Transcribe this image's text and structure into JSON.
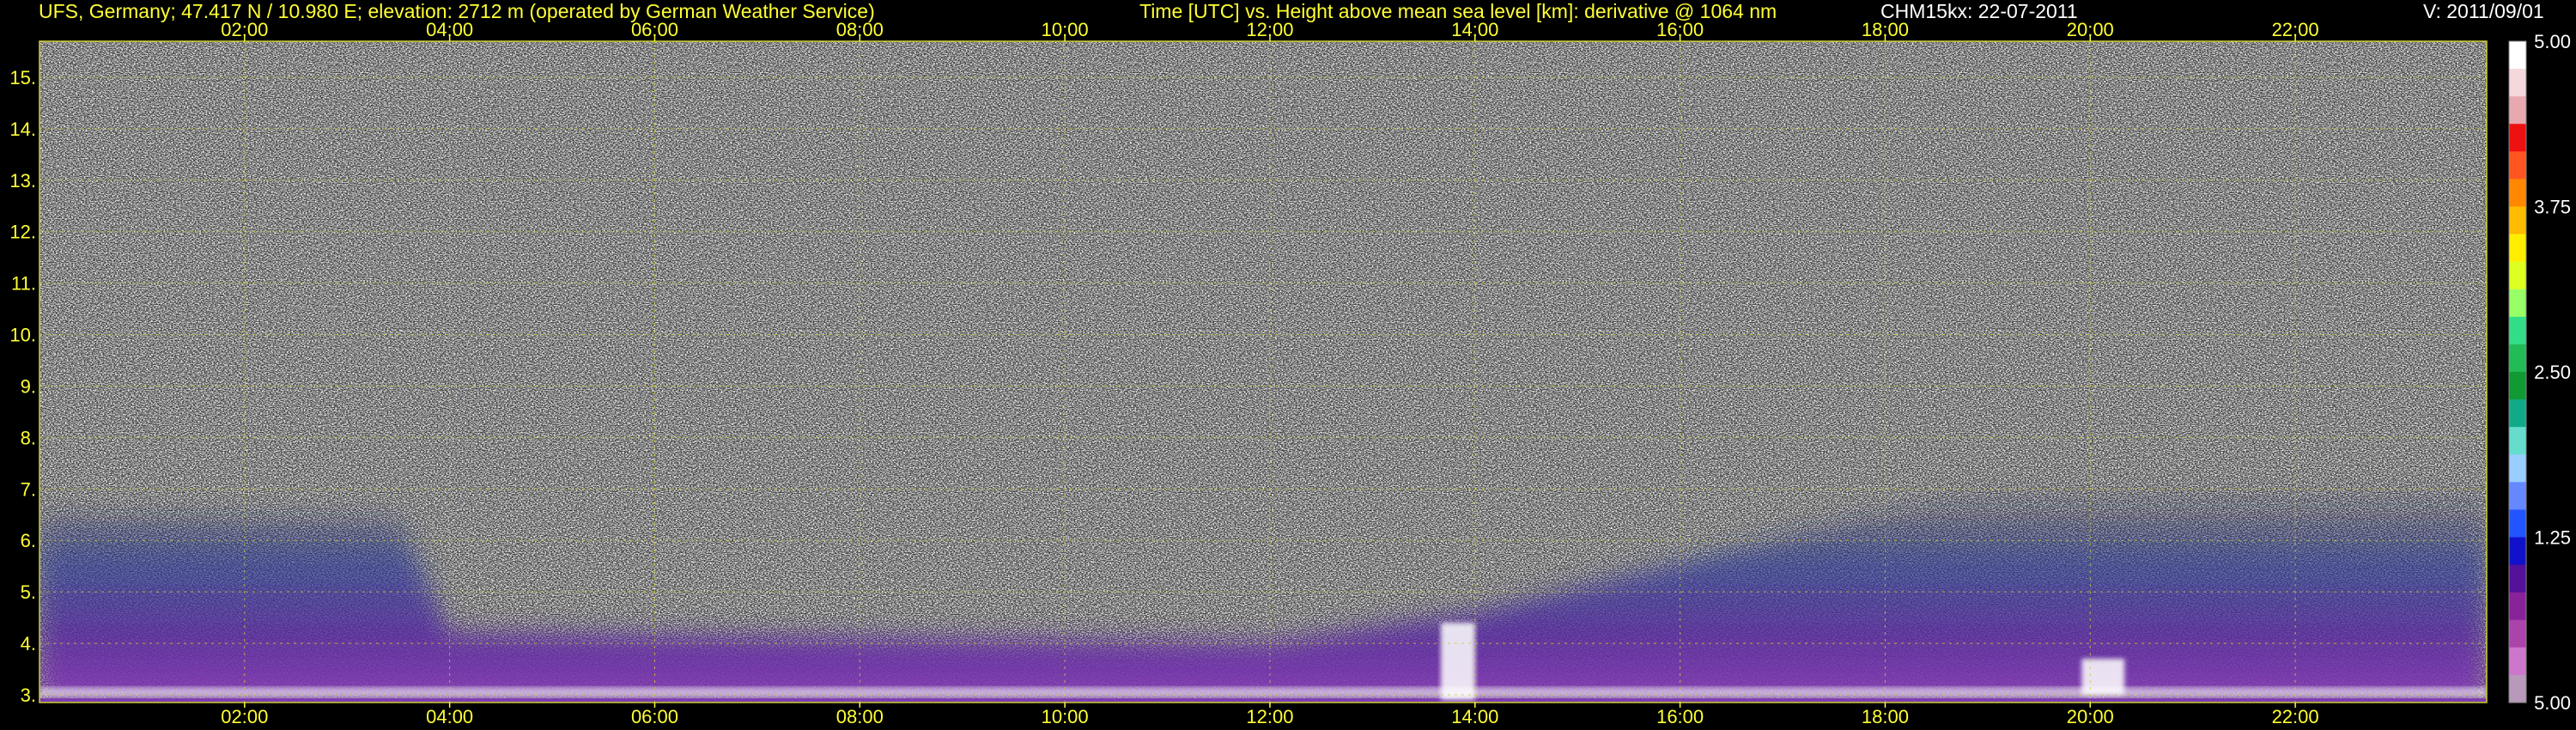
{
  "header": {
    "station": "UFS, Germany; 47.417 N / 10.980 E; elevation: 2712 m  (operated by German Weather Service)",
    "axes_desc": "Time [UTC] vs. Height above mean sea level [km]: derivative @ 1064 nm",
    "instrument_date": "CHM15kx: 22-07-2011",
    "version": "V: 2011/09/01"
  },
  "colors": {
    "text": "#ffff33",
    "grid": "#cccc33",
    "background": "#000000",
    "colorbar_text": "#ffffff"
  },
  "chart_data": {
    "type": "heatmap",
    "x": {
      "label": "Time [UTC]",
      "range": [
        "00:00",
        "23:52"
      ],
      "ticks": [
        "02:00",
        "04:00",
        "06:00",
        "08:00",
        "10:00",
        "12:00",
        "14:00",
        "16:00",
        "18:00",
        "20:00",
        "22:00"
      ]
    },
    "y": {
      "label": "Height above mean sea level [km]",
      "range": [
        2.85,
        15.7
      ],
      "ticks": [
        "3.",
        "4.",
        "5.",
        "6.",
        "7.",
        "8.",
        "9.",
        "10.",
        "11.",
        "12.",
        "13.",
        "14.",
        "15."
      ]
    },
    "colorbar": {
      "labels": [
        "5.00",
        "3.75",
        "2.50",
        "1.25",
        "5.00"
      ],
      "colors": [
        "#ffffff",
        "#f4d8dc",
        "#e8a8b0",
        "#ee1111",
        "#ff5522",
        "#ff8800",
        "#ffbb00",
        "#ffee00",
        "#ddff22",
        "#99ff66",
        "#33dd88",
        "#22bb55",
        "#119933",
        "#11aa88",
        "#66ddcc",
        "#99ccff",
        "#6688ff",
        "#2255ff",
        "#1111cc",
        "#551199",
        "#882299",
        "#aa44aa",
        "#cc77cc",
        "#b899bb"
      ]
    },
    "grid": true,
    "features": {
      "aerosol_layer_top_km": [
        {
          "time": "00:00",
          "height": 6.5
        },
        {
          "time": "03:30",
          "height": 6.4
        },
        {
          "time": "04:00",
          "height": 4.2
        },
        {
          "time": "12:00",
          "height": 4.0
        },
        {
          "time": "14:00",
          "height": 4.6
        },
        {
          "time": "16:30",
          "height": 5.8
        },
        {
          "time": "19:00",
          "height": 7.0
        },
        {
          "time": "23:52",
          "height": 7.0
        }
      ],
      "cloud_events": [
        {
          "start": "13:40",
          "end": "14:00",
          "base": 2.9,
          "top": 4.4
        },
        {
          "start": "19:55",
          "end": "20:20",
          "base": 3.0,
          "top": 3.7
        }
      ]
    }
  }
}
